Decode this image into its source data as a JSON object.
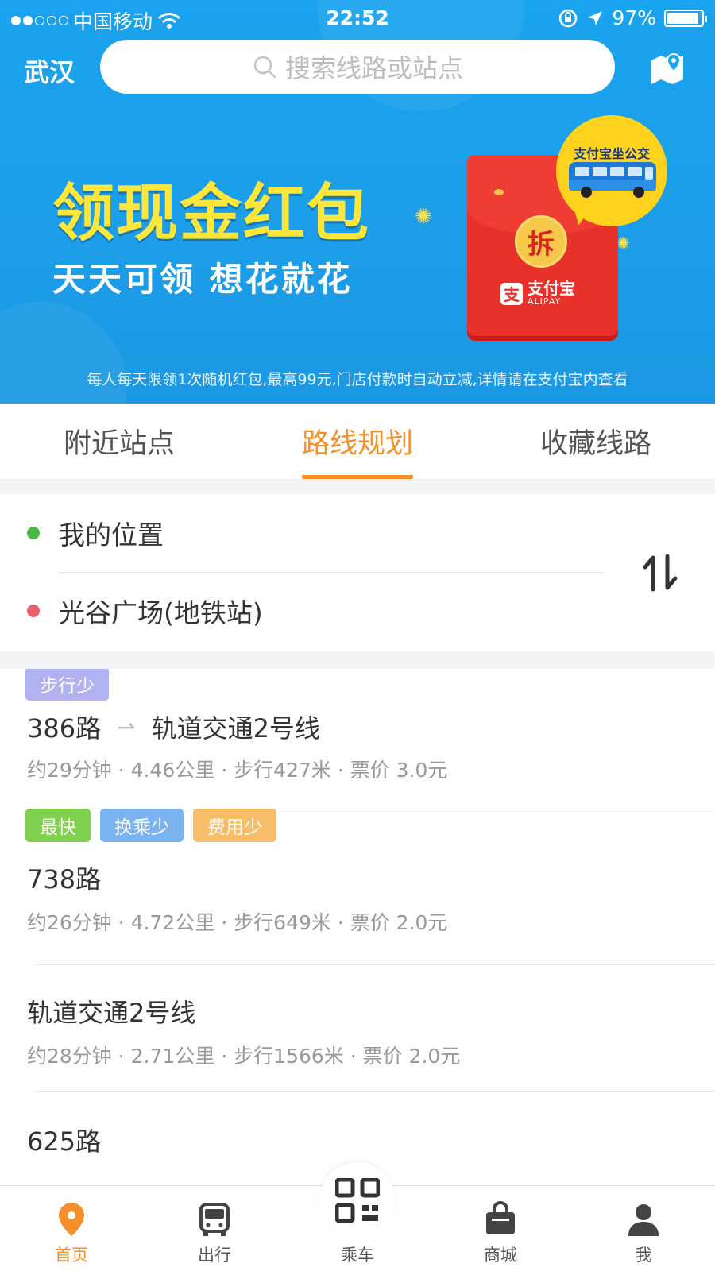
{
  "status_bar": {
    "carrier": "中国移动",
    "time": "22:52",
    "battery": "97%"
  },
  "header": {
    "city": "武汉",
    "search_placeholder": "搜索线路或站点"
  },
  "banner": {
    "title": "领现金红包",
    "subtitle": "天天可领  想花就花",
    "note": "每人每天限领1次随机红包,最高99元,门店付款时自动立减,详情请在支付宝内查看",
    "badge_text": "支付宝坐公交",
    "envelope_button": "拆",
    "envelope_brand": "支付宝",
    "envelope_brand_en": "ALIPAY",
    "envelope_brand_mark": "支"
  },
  "tabs": [
    {
      "label": "附近站点",
      "active": false
    },
    {
      "label": "路线规划",
      "active": true
    },
    {
      "label": "收藏线路",
      "active": false
    }
  ],
  "route": {
    "origin": "我的位置",
    "destination": "光谷广场(地铁站)",
    "origin_color": "#4cb848",
    "destination_color": "#e8606a"
  },
  "results": [
    {
      "tags": [
        {
          "label": "步行少",
          "color": "#b1b2f0"
        }
      ],
      "segments": [
        "386路",
        "轨道交通2号线"
      ],
      "meta": "约29分钟 · 4.46公里 · 步行427米 · 票价  3.0元"
    },
    {
      "tags": [
        {
          "label": "最快",
          "color": "#7ed04d"
        },
        {
          "label": "换乘少",
          "color": "#7ab3f0"
        },
        {
          "label": "费用少",
          "color": "#f8bd68"
        }
      ],
      "segments": [
        "738路"
      ],
      "meta": "约26分钟 · 4.72公里 · 步行649米 · 票价  2.0元"
    },
    {
      "tags": [],
      "segments": [
        "轨道交通2号线"
      ],
      "meta": "约28分钟 · 2.71公里 · 步行1566米 · 票价  2.0元"
    },
    {
      "tags": [],
      "segments": [
        "625路"
      ],
      "meta": ""
    }
  ],
  "nav": [
    {
      "label": "首页",
      "icon": "location-pin-icon",
      "active": true
    },
    {
      "label": "出行",
      "icon": "bus-icon",
      "active": false
    },
    {
      "label": "乘车",
      "icon": "qr-code-icon",
      "active": false
    },
    {
      "label": "商城",
      "icon": "shopping-bag-icon",
      "active": false
    },
    {
      "label": "我",
      "icon": "person-icon",
      "active": false
    }
  ],
  "colors": {
    "accent": "#f3902b",
    "header_blue": "#1aa3ee",
    "banner_yellow": "#ffe63b"
  }
}
